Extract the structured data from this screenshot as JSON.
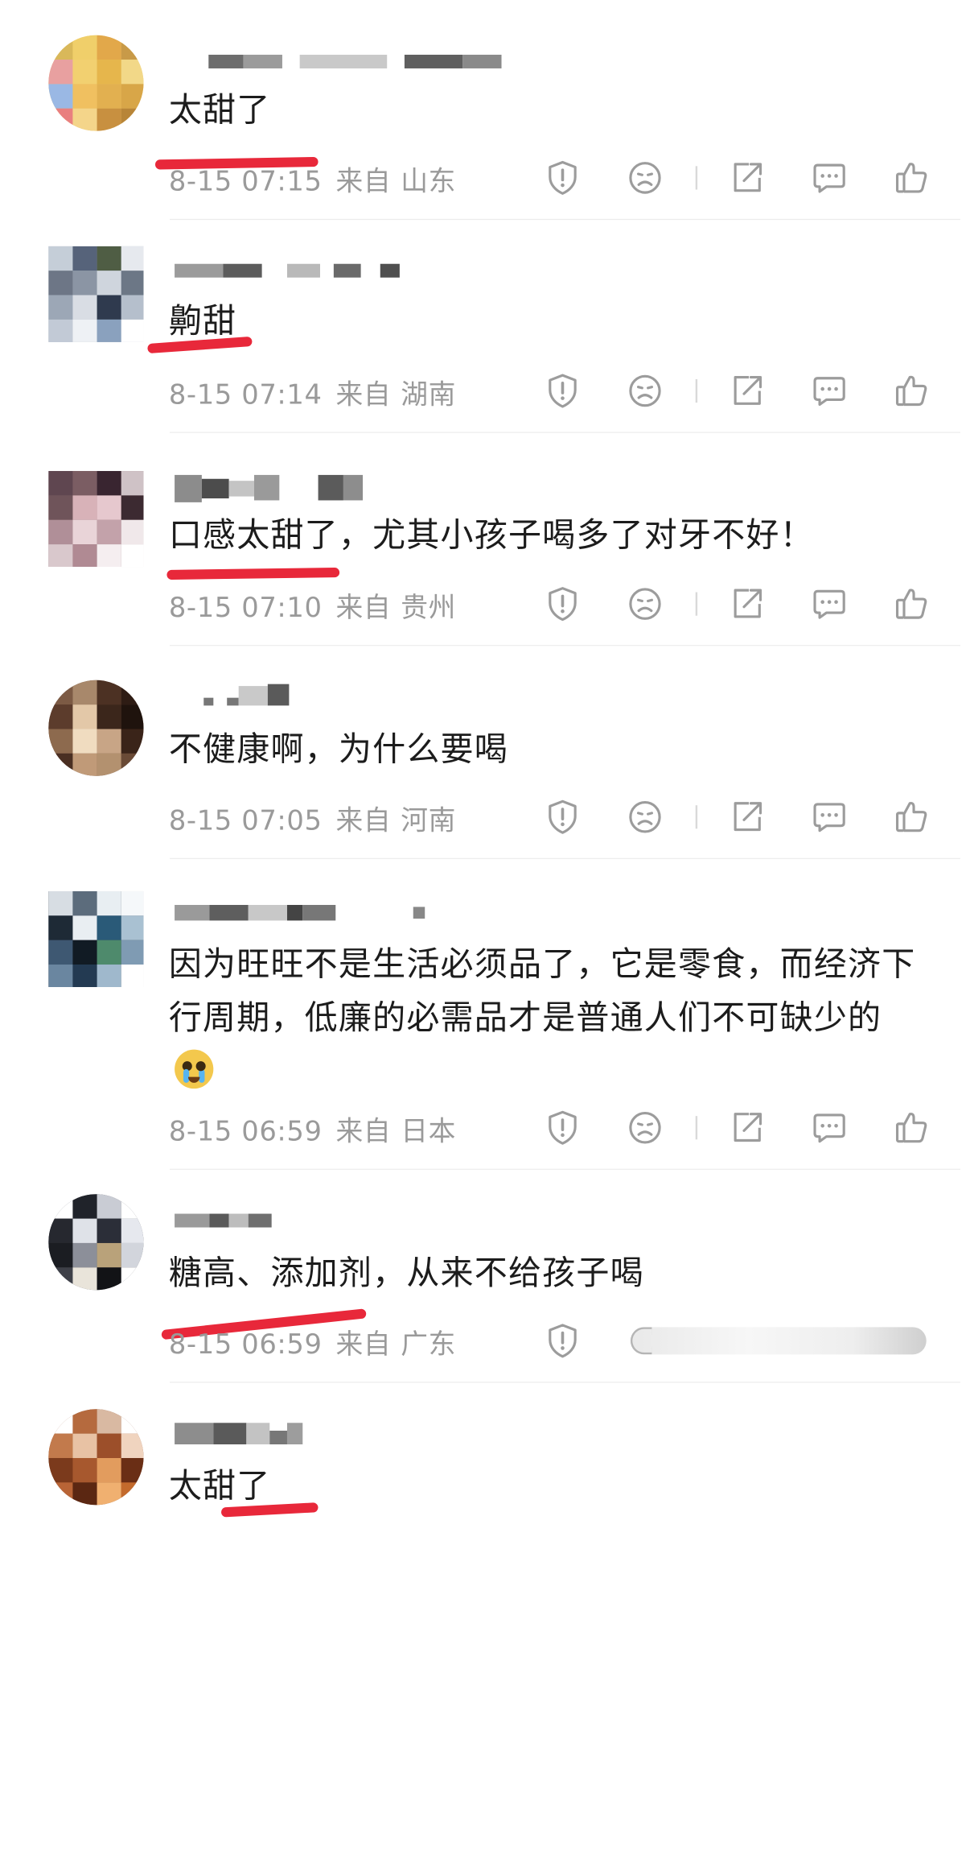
{
  "comments": [
    {
      "text": "太甜了",
      "time": "8-15 07:15",
      "from_label": "来自",
      "location": "山东"
    },
    {
      "text": "齁甜",
      "time": "8-15 07:14",
      "from_label": "来自",
      "location": "湖南"
    },
    {
      "text": "口感太甜了，尤其小孩子喝多了对牙不好！",
      "time": "8-15 07:10",
      "from_label": "来自",
      "location": "贵州"
    },
    {
      "text": "不健康啊，为什么要喝",
      "time": "8-15 07:05",
      "from_label": "来自",
      "location": "河南"
    },
    {
      "text": "因为旺旺不是生活必须品了，它是零食，而经济下行周期，低廉的必需品才是普通人们不可缺少的",
      "time": "8-15 06:59",
      "from_label": "来自",
      "location": "日本"
    },
    {
      "text": "糖高、添加剂，从来不给孩子喝",
      "time": "8-15 06:59",
      "from_label": "来自",
      "location": "广东"
    },
    {
      "text": "太甜了"
    }
  ],
  "icons": {
    "report": "shield-exclamation-icon",
    "dislike": "frown-face-icon",
    "share": "share-box-icon",
    "reply": "chat-bubble-icon",
    "like": "thumbs-up-icon"
  },
  "colors": {
    "text": "#1c1c1c",
    "meta": "#9a9a9a",
    "icon": "#9c9c9c",
    "highlight": "#e8283a"
  }
}
